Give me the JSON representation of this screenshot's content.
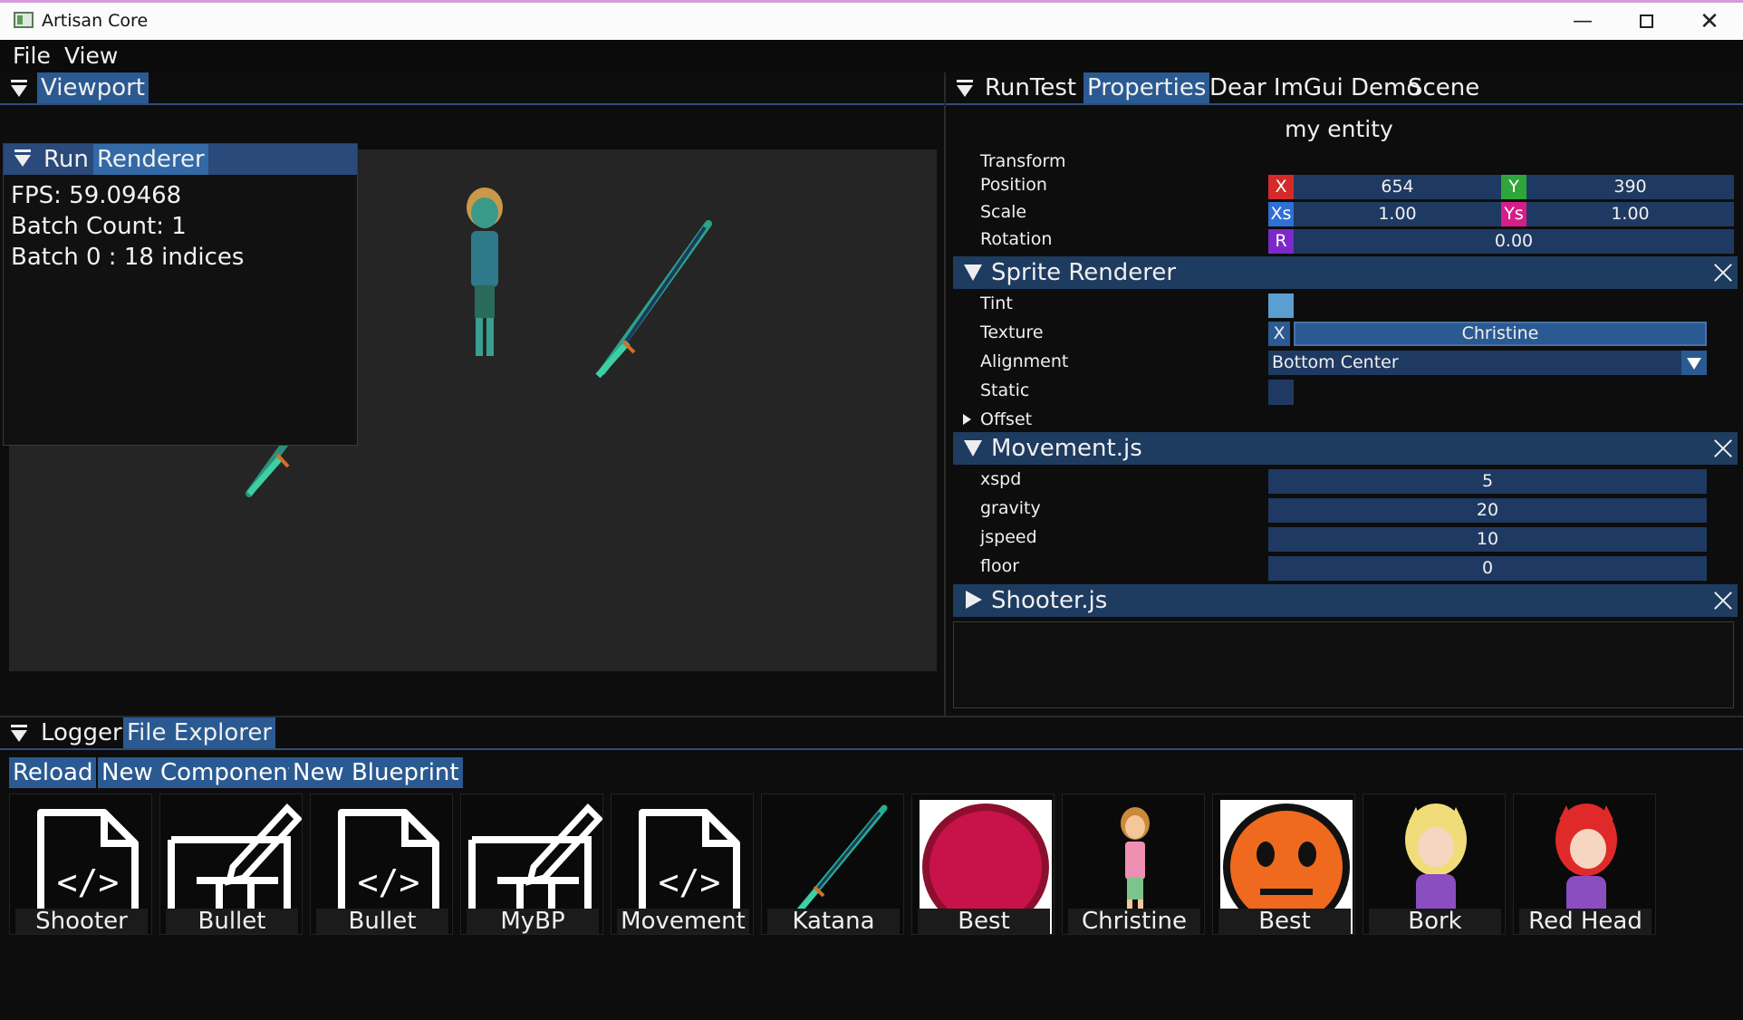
{
  "window": {
    "title": "Artisan Core"
  },
  "menu": [
    "File",
    "View"
  ],
  "viewport": {
    "tab": "Viewport"
  },
  "run_window": {
    "tabs": [
      "Run",
      "Renderer"
    ],
    "lines": [
      "FPS: 59.09468",
      "Batch Count: 1",
      "Batch 0 : 18 indices"
    ]
  },
  "right_panel": {
    "tabs": [
      "RunTest",
      "Properties",
      "Dear ImGui Demo",
      "Scene"
    ],
    "entity_name": "my entity",
    "transform": {
      "title": "Transform",
      "position_label": "Position",
      "scale_label": "Scale",
      "rotation_label": "Rotation",
      "x_label": "X",
      "x": "654",
      "y_label": "Y",
      "y": "390",
      "xs_label": "Xs",
      "xs": "1.00",
      "ys_label": "Ys",
      "ys": "1.00",
      "r_label": "R",
      "r": "0.00"
    },
    "sprite_renderer": {
      "title": "Sprite Renderer",
      "tint_label": "Tint",
      "texture_label": "Texture",
      "texture_clear": "X",
      "texture_value": "Christine",
      "alignment_label": "Alignment",
      "alignment_value": "Bottom Center",
      "static_label": "Static",
      "offset_label": "Offset",
      "tint_color": "#5b9ed1"
    },
    "movement": {
      "title": "Movement.js",
      "fields": [
        {
          "label": "xspd",
          "value": "5"
        },
        {
          "label": "gravity",
          "value": "20"
        },
        {
          "label": "jspeed",
          "value": "10"
        },
        {
          "label": "floor",
          "value": "0"
        }
      ]
    },
    "shooter": {
      "title": "Shooter.js"
    }
  },
  "bottom_panel": {
    "tabs": [
      "Logger",
      "File Explorer"
    ],
    "buttons": [
      "Reload",
      "New Component",
      "New Blueprint"
    ],
    "files": [
      {
        "name": "Shooter",
        "icon": "code-file-icon"
      },
      {
        "name": "Bullet",
        "icon": "blueprint-icon"
      },
      {
        "name": "Bullet",
        "icon": "code-file-icon"
      },
      {
        "name": "MyBP",
        "icon": "blueprint-icon"
      },
      {
        "name": "Movement",
        "icon": "code-file-icon"
      },
      {
        "name": "Katana",
        "icon": "katana-sprite"
      },
      {
        "name": "Best",
        "icon": "red-ball-sprite"
      },
      {
        "name": "Christine",
        "icon": "christine-sprite"
      },
      {
        "name": "Best",
        "icon": "orange-face-sprite"
      },
      {
        "name": "Bork",
        "icon": "bork-sprite"
      },
      {
        "name": "Red Head",
        "icon": "red-head-sprite"
      }
    ]
  },
  "colors": {
    "accent": "#2a5a91",
    "field": "#1f3a62",
    "header": "#1e3b60",
    "x_red": "#d42a2a",
    "y_green": "#2fa63a",
    "xs_blue": "#2f6fd6",
    "ys_pink": "#d61e8a",
    "r_purple": "#7d28c9"
  }
}
